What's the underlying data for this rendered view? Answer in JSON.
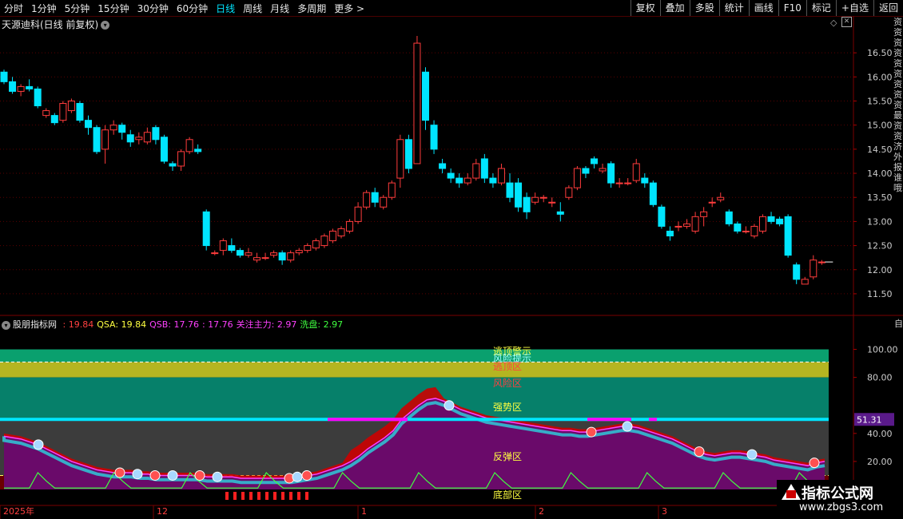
{
  "toolbar": {
    "tabs": [
      "分时",
      "1分钟",
      "5分钟",
      "15分钟",
      "30分钟",
      "60分钟",
      "日线",
      "周线",
      "月线",
      "多周期",
      "更多 >"
    ],
    "active_tab": "日线",
    "right_buttons": [
      "复权",
      "叠加",
      "多股",
      "统计",
      "画线",
      "F10",
      "标记",
      "+自选",
      "返回"
    ]
  },
  "main_chart": {
    "title": "天源迪科(日线 前复权)",
    "y_ticks": [
      "16.50",
      "16.00",
      "15.50",
      "15.00",
      "14.50",
      "14.00",
      "13.50",
      "13.00",
      "12.50",
      "12.00",
      "11.50"
    ],
    "last_price_marker": "12.16",
    "right_side_text": "资资资资资资资资资最资资济外报谁哦"
  },
  "indicator": {
    "name": "股朋指标网",
    "fields": [
      {
        "label": "",
        "value": ": 19.84",
        "color": "#ff4040"
      },
      {
        "label": "QSA: ",
        "value": "19.84",
        "color": "#ffff40"
      },
      {
        "label": "QSB: ",
        "value": "17.76",
        "color": "#ff40ff"
      },
      {
        "label": "",
        "value": ": 17.76",
        "color": "#ff40ff"
      },
      {
        "label": "关注主力: ",
        "value": "2.97",
        "color": "#ff40ff"
      },
      {
        "label": "洗盘: ",
        "value": "2.97",
        "color": "#40ff40"
      }
    ],
    "zone_labels": [
      "逃顶警示",
      "风险提示",
      "逃顶区",
      "风险区",
      "强势区",
      "反弹区",
      "底部区"
    ],
    "y_ticks": [
      "100.00",
      "80.00",
      "40.00",
      "20.00"
    ],
    "current_value": "51.31",
    "right_side_text": "自交"
  },
  "time_axis": [
    "2025年",
    "12",
    "1",
    "2",
    "3"
  ],
  "watermark": {
    "title": "指标公式网",
    "url": "www.zbgs3.com"
  },
  "colors": {
    "up": "#ff3c3c",
    "down": "#00e5ff",
    "grid": "#5a0000",
    "bg": "#000000"
  },
  "chart_data": {
    "type": "candlestick",
    "y_range": [
      11.3,
      16.9
    ],
    "candles": [
      [
        16.1,
        15.9,
        16.15,
        15.85
      ],
      [
        15.9,
        15.7,
        16.0,
        15.65
      ],
      [
        15.7,
        15.8,
        15.85,
        15.6
      ],
      [
        15.8,
        15.75,
        15.95,
        15.7
      ],
      [
        15.75,
        15.4,
        15.8,
        15.35
      ],
      [
        15.2,
        15.3,
        15.35,
        15.15
      ],
      [
        15.2,
        15.05,
        15.25,
        15.0
      ],
      [
        15.1,
        15.45,
        15.5,
        15.05
      ],
      [
        15.3,
        15.5,
        15.55,
        15.25
      ],
      [
        15.45,
        15.1,
        15.5,
        15.05
      ],
      [
        15.1,
        14.95,
        15.2,
        14.8
      ],
      [
        14.95,
        14.45,
        15.0,
        14.4
      ],
      [
        14.5,
        14.9,
        15.0,
        14.2
      ],
      [
        14.9,
        15.0,
        15.1,
        14.8
      ],
      [
        15.0,
        14.85,
        15.05,
        14.7
      ],
      [
        14.8,
        14.65,
        14.9,
        14.55
      ],
      [
        14.7,
        14.75,
        14.85,
        14.6
      ],
      [
        14.65,
        14.85,
        14.95,
        14.6
      ],
      [
        14.95,
        14.7,
        15.0,
        14.6
      ],
      [
        14.75,
        14.25,
        14.8,
        14.2
      ],
      [
        14.2,
        14.15,
        14.25,
        14.05
      ],
      [
        14.15,
        14.45,
        14.5,
        14.05
      ],
      [
        14.45,
        14.7,
        14.75,
        14.4
      ],
      [
        14.5,
        14.45,
        14.6,
        14.4
      ],
      [
        13.2,
        12.5,
        13.25,
        12.4
      ],
      [
        12.35,
        12.35,
        12.4,
        12.3
      ],
      [
        12.4,
        12.6,
        12.65,
        12.3
      ],
      [
        12.5,
        12.4,
        12.65,
        12.35
      ],
      [
        12.4,
        12.3,
        12.45,
        12.25
      ],
      [
        12.3,
        12.35,
        12.45,
        12.25
      ],
      [
        12.2,
        12.25,
        12.35,
        12.15
      ],
      [
        12.25,
        12.25,
        12.35,
        12.2
      ],
      [
        12.3,
        12.35,
        12.4,
        12.25
      ],
      [
        12.35,
        12.2,
        12.4,
        12.1
      ],
      [
        12.2,
        12.35,
        12.4,
        12.15
      ],
      [
        12.35,
        12.4,
        12.45,
        12.3
      ],
      [
        12.4,
        12.5,
        12.55,
        12.35
      ],
      [
        12.45,
        12.6,
        12.65,
        12.4
      ],
      [
        12.5,
        12.7,
        12.75,
        12.45
      ],
      [
        12.6,
        12.8,
        12.85,
        12.55
      ],
      [
        12.7,
        12.85,
        12.9,
        12.65
      ],
      [
        12.8,
        13.0,
        13.05,
        12.75
      ],
      [
        13.0,
        13.3,
        13.4,
        12.95
      ],
      [
        13.3,
        13.6,
        13.65,
        13.25
      ],
      [
        13.6,
        13.4,
        13.7,
        13.3
      ],
      [
        13.3,
        13.5,
        13.55,
        13.25
      ],
      [
        13.5,
        13.8,
        13.85,
        13.45
      ],
      [
        13.9,
        14.7,
        14.8,
        13.7
      ],
      [
        14.7,
        14.1,
        14.8,
        14.0
      ],
      [
        14.2,
        16.7,
        16.85,
        14.2
      ],
      [
        16.1,
        15.1,
        16.2,
        14.9
      ],
      [
        15.0,
        14.5,
        15.1,
        14.4
      ],
      [
        14.2,
        14.1,
        14.3,
        14.0
      ],
      [
        14.0,
        13.9,
        14.1,
        13.8
      ],
      [
        13.9,
        13.8,
        14.0,
        13.7
      ],
      [
        13.8,
        13.9,
        14.0,
        13.75
      ],
      [
        13.9,
        14.2,
        14.3,
        13.85
      ],
      [
        14.3,
        13.9,
        14.4,
        13.8
      ],
      [
        13.9,
        13.8,
        14.0,
        13.7
      ],
      [
        13.8,
        14.1,
        14.2,
        13.75
      ],
      [
        13.8,
        13.5,
        14.0,
        13.4
      ],
      [
        13.8,
        13.3,
        13.9,
        13.2
      ],
      [
        13.5,
        13.2,
        13.6,
        13.05
      ],
      [
        13.4,
        13.5,
        13.6,
        13.35
      ],
      [
        13.5,
        13.5,
        13.55,
        13.4
      ],
      [
        13.4,
        13.4,
        13.5,
        13.3
      ],
      [
        13.2,
        13.15,
        13.4,
        13.0
      ],
      [
        13.5,
        13.7,
        13.75,
        13.45
      ],
      [
        13.7,
        14.1,
        14.15,
        13.65
      ],
      [
        14.1,
        14.0,
        14.15,
        13.9
      ],
      [
        14.3,
        14.2,
        14.35,
        14.1
      ],
      [
        14.05,
        14.1,
        14.2,
        14.0
      ],
      [
        14.2,
        13.8,
        14.25,
        13.7
      ],
      [
        13.8,
        13.8,
        13.9,
        13.7
      ],
      [
        13.8,
        13.8,
        13.9,
        13.75
      ],
      [
        13.85,
        14.2,
        14.3,
        13.8
      ],
      [
        13.9,
        13.8,
        14.0,
        13.7
      ],
      [
        13.8,
        13.35,
        13.85,
        13.3
      ],
      [
        13.3,
        12.9,
        13.35,
        12.85
      ],
      [
        12.8,
        12.7,
        12.9,
        12.6
      ],
      [
        12.9,
        12.9,
        13.0,
        12.8
      ],
      [
        12.9,
        12.95,
        13.05,
        12.85
      ],
      [
        12.8,
        13.1,
        13.2,
        12.75
      ],
      [
        13.1,
        13.2,
        13.3,
        12.9
      ],
      [
        13.4,
        13.4,
        13.5,
        13.3
      ],
      [
        13.45,
        13.5,
        13.6,
        13.4
      ],
      [
        13.2,
        12.95,
        13.25,
        12.9
      ],
      [
        12.95,
        12.8,
        13.0,
        12.75
      ],
      [
        12.8,
        12.8,
        12.9,
        12.75
      ],
      [
        12.7,
        12.9,
        12.95,
        12.65
      ],
      [
        12.8,
        13.1,
        13.15,
        12.75
      ],
      [
        13.1,
        13.0,
        13.2,
        12.95
      ],
      [
        13.05,
        12.95,
        13.1,
        12.9
      ],
      [
        13.1,
        12.3,
        13.15,
        12.25
      ],
      [
        12.1,
        11.8,
        12.15,
        11.7
      ],
      [
        11.7,
        11.8,
        11.85,
        11.7
      ],
      [
        11.85,
        12.2,
        12.3,
        11.8
      ],
      [
        12.15,
        12.16,
        12.2,
        12.1
      ]
    ],
    "indicator_series": {
      "y_range": [
        0,
        110
      ],
      "qsa": [
        38,
        37,
        36,
        34,
        32,
        29,
        26,
        23,
        20,
        18,
        16,
        14,
        13,
        12,
        12,
        12,
        11,
        11,
        10,
        10,
        10,
        10,
        10,
        10,
        9,
        9,
        9,
        9,
        8,
        8,
        8,
        8,
        8,
        8,
        8,
        9,
        10,
        11,
        13,
        15,
        17,
        20,
        24,
        29,
        33,
        37,
        42,
        50,
        55,
        60,
        64,
        65,
        63,
        60,
        57,
        55,
        53,
        51,
        50,
        49,
        48,
        47,
        46,
        45,
        44,
        43,
        42,
        42,
        41,
        41,
        42,
        43,
        44,
        45,
        45,
        44,
        42,
        40,
        38,
        36,
        33,
        30,
        27,
        25,
        24,
        25,
        26,
        26,
        25,
        24,
        23,
        21,
        20,
        19,
        18,
        17,
        19,
        20
      ]
    }
  }
}
